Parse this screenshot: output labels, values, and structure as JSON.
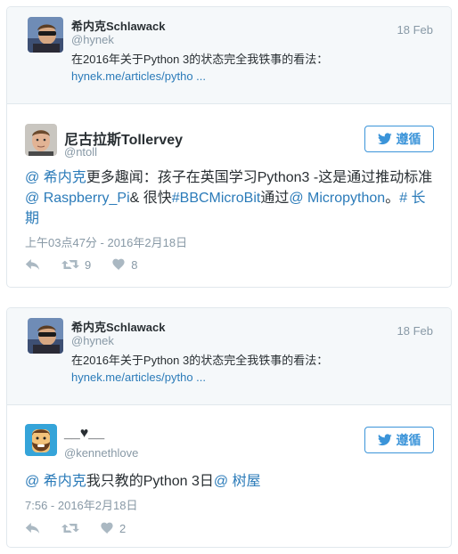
{
  "tweet1": {
    "quoted": {
      "name": "希内克Schlawack",
      "handle": "@hynek",
      "date": "18 Feb",
      "text": "在2016年关于Python 3的状态完全我铁事的看法：",
      "link": "hynek.me/articles/pytho ..."
    },
    "author": {
      "name": "尼古拉斯Tollervey",
      "handle": "@ntoll"
    },
    "follow_label": "遵循",
    "body": {
      "mention1": "@ 希内克",
      "text1": "更多趣闻：孩子在英国学习Python3 -这是通过推动标准 ",
      "mention2": "@ Raspberry_Pi",
      "text2": "& 很快",
      "hashtag1": "#BBCMicroBit",
      "text3": "通过",
      "mention3": "@ Micropython",
      "text4": "。",
      "hashtag2": "# 长期"
    },
    "timestamp": "上午03点47分 - 2016年2月18日",
    "retweets": "9",
    "likes": "8"
  },
  "tweet2": {
    "quoted": {
      "name": "希内克Schlawack",
      "handle": "@hynek",
      "date": "18 Feb",
      "text": "在2016年关于Python 3的状态完全我铁事的看法：",
      "link": "hynek.me/articles/pytho ..."
    },
    "author": {
      "name": "__♥__",
      "handle": "@kennethlove"
    },
    "follow_label": "遵循",
    "body": {
      "mention1": "@ 希内克",
      "text1": "我只教的Python 3日",
      "mention2": "@ 树屋"
    },
    "timestamp": "7:56 - 2016年2月18日",
    "likes": "2"
  },
  "icons": [
    "reply-icon",
    "retweet-icon",
    "heart-icon",
    "twitter-bird-icon"
  ],
  "colors": {
    "link": "#2b7bb9",
    "follow": "#3b94d9",
    "muted": "#8899a6",
    "icon": "#aab8c2"
  }
}
